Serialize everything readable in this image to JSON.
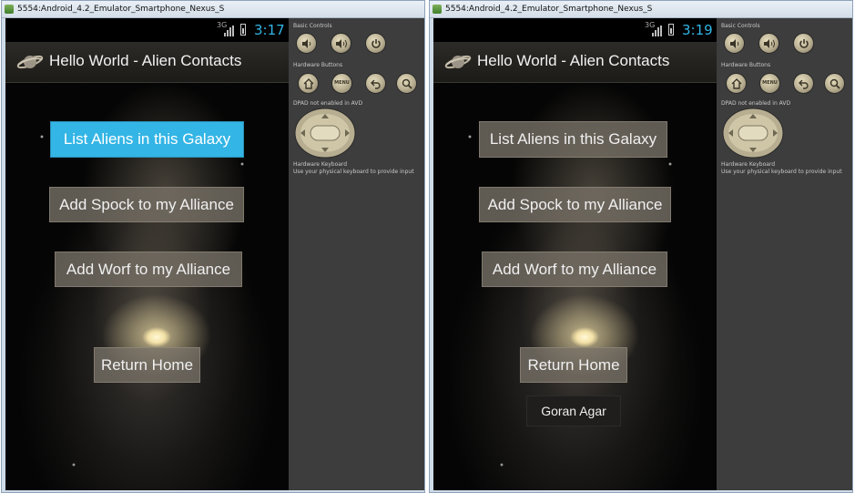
{
  "windows": [
    {
      "titlebar": {
        "title": "5554:Android_4.2_Emulator_Smartphone_Nexus_S"
      },
      "statusbar": {
        "network": "3G",
        "time": "3:17"
      },
      "actionbar": {
        "title": "Hello World - Alien Contacts"
      },
      "buttons": {
        "list_aliens": "List Aliens in this Galaxy",
        "add_spock": "Add Spock to my Alliance",
        "add_worf": "Add Worf to my Alliance",
        "return_home": "Return Home"
      },
      "active_button": "list_aliens",
      "toast": null,
      "panel": {
        "basic_controls": "Basic Controls",
        "hardware_buttons": "Hardware Buttons",
        "menu_label": "MENU",
        "dpad_note": "DPAD not enabled in AVD",
        "keyboard_title": "Hardware Keyboard",
        "keyboard_note": "Use your physical keyboard to provide input"
      }
    },
    {
      "titlebar": {
        "title": "5554:Android_4.2_Emulator_Smartphone_Nexus_S"
      },
      "statusbar": {
        "network": "3G",
        "time": "3:19"
      },
      "actionbar": {
        "title": "Hello World - Alien Contacts"
      },
      "buttons": {
        "list_aliens": "List Aliens in this Galaxy",
        "add_spock": "Add Spock to my Alliance",
        "add_worf": "Add Worf to my Alliance",
        "return_home": "Return Home"
      },
      "active_button": null,
      "toast": "Goran Agar",
      "panel": {
        "basic_controls": "Basic Controls",
        "hardware_buttons": "Hardware Buttons",
        "menu_label": "MENU",
        "dpad_note": "DPAD not enabled in AVD",
        "keyboard_title": "Hardware Keyboard",
        "keyboard_note": "Use your physical keyboard to provide input"
      }
    }
  ],
  "colors": {
    "active_button": "#33b5e5",
    "clock": "#33b5e5",
    "panel_bg": "#3d3d3d"
  },
  "icons": [
    "app-icon",
    "signal-icon",
    "battery-icon",
    "planet-icon",
    "volume-down-icon",
    "volume-up-icon",
    "power-icon",
    "home-icon",
    "back-icon",
    "search-icon",
    "dpad-icon"
  ]
}
